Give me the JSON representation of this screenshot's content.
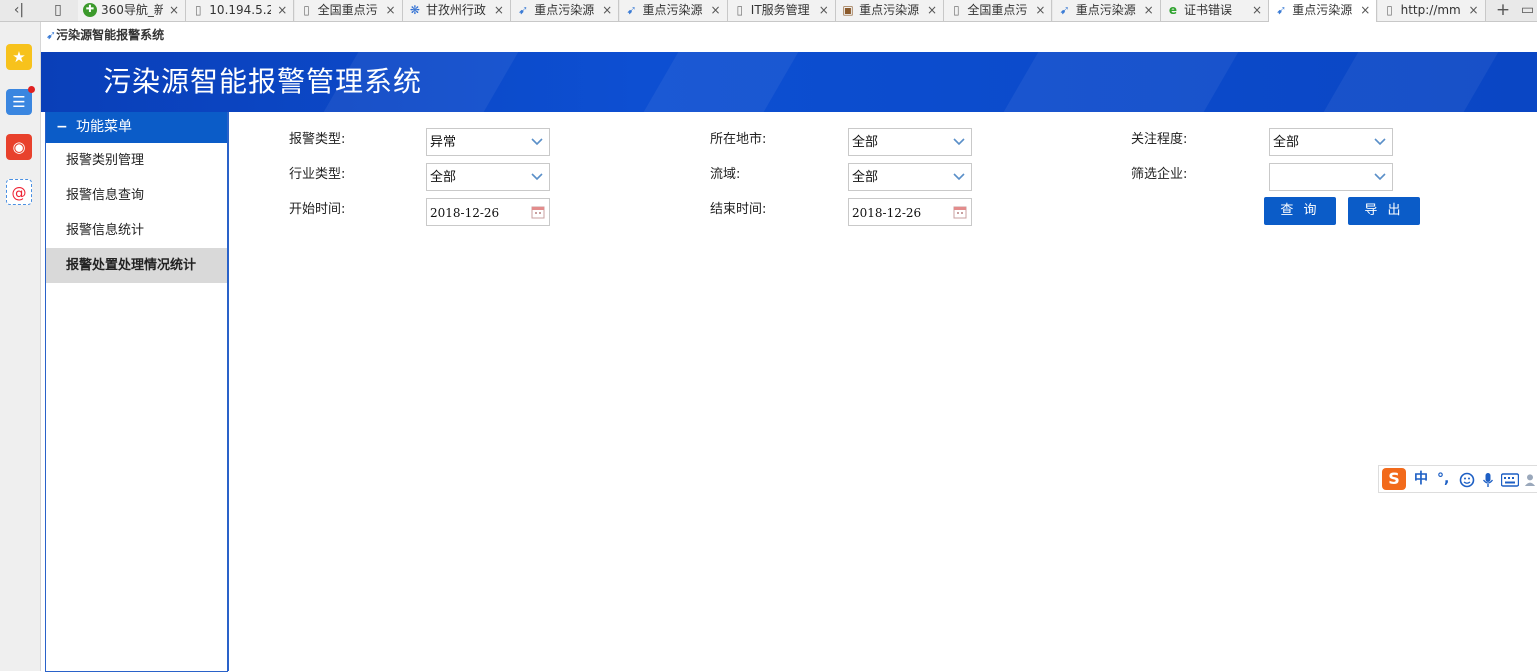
{
  "browser": {
    "back_icon": "collapse-left-icon",
    "tabs": [
      {
        "title": "360导航_新",
        "icon": "360-nav-icon",
        "active": false
      },
      {
        "title": "10.194.5.2",
        "icon": "page-icon",
        "active": false
      },
      {
        "title": "全国重点污",
        "icon": "page-icon",
        "active": false
      },
      {
        "title": "甘孜州行政",
        "icon": "baidu-paw-icon",
        "active": false
      },
      {
        "title": "重点污染源",
        "icon": "site-bird-icon",
        "active": false
      },
      {
        "title": "重点污染源",
        "icon": "site-bird-icon",
        "active": false
      },
      {
        "title": "IT服务管理",
        "icon": "page-icon",
        "active": false
      },
      {
        "title": "重点污染源",
        "icon": "image-icon",
        "active": false
      },
      {
        "title": "全国重点污",
        "icon": "page-icon",
        "active": false
      },
      {
        "title": "重点污染源",
        "icon": "site-bird-icon",
        "active": false
      },
      {
        "title": "证书错误",
        "icon": "ie-error-icon",
        "active": false
      },
      {
        "title": "重点污染源",
        "icon": "site-bird-icon",
        "active": true
      },
      {
        "title": "http://mm",
        "icon": "page-icon",
        "active": false
      }
    ],
    "new_tab_label": "+",
    "sidebar_icons": [
      "star-favorites-icon",
      "news-list-icon",
      "weibo-icon",
      "email-at-icon"
    ]
  },
  "page": {
    "title": "污染源智能报警系统",
    "banner_title": "污染源智能报警管理系统"
  },
  "menu": {
    "header": "功能菜单",
    "collapse_symbol": "−",
    "items": [
      {
        "label": "报警类别管理",
        "active": false
      },
      {
        "label": "报警信息查询",
        "active": false
      },
      {
        "label": "报警信息统计",
        "active": false
      },
      {
        "label": "报警处置处理情况统计",
        "active": true
      }
    ]
  },
  "form": {
    "alarm_type": {
      "label": "报警类型:",
      "value": "异常"
    },
    "city": {
      "label": "所在地市:",
      "value": "全部"
    },
    "attention": {
      "label": "关注程度:",
      "value": "全部"
    },
    "industry": {
      "label": "行业类型:",
      "value": "全部"
    },
    "basin": {
      "label": "流域:",
      "value": "全部"
    },
    "enterprise": {
      "label": "筛选企业:",
      "value": ""
    },
    "start_time": {
      "label": "开始时间:",
      "value": "2018-12-26"
    },
    "end_time": {
      "label": "结束时间:",
      "value": "2018-12-26"
    },
    "query_button": "查 询",
    "export_button": "导 出"
  },
  "ime": {
    "logo": "S",
    "lang": "中",
    "punct": "°,",
    "icons": [
      "emoji-icon",
      "microphone-icon",
      "keyboard-icon",
      "user-icon"
    ]
  },
  "colors": {
    "banner": "#0b4fd0",
    "menu_header": "#0b5cc8",
    "button": "#0b5cc8",
    "active_menu_bg": "#d9d9d9"
  }
}
